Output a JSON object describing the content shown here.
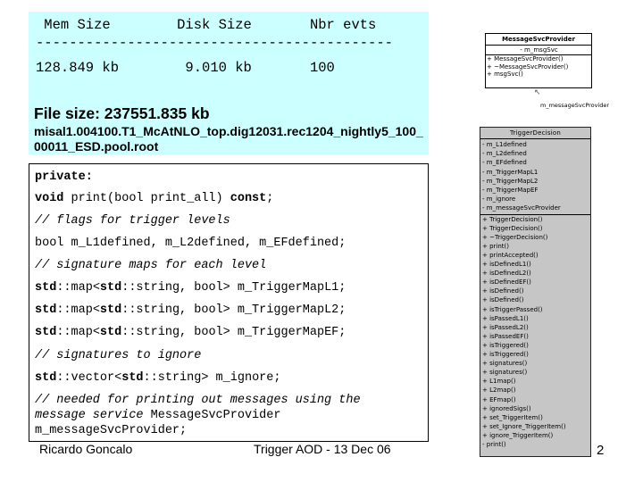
{
  "info": {
    "header": " Mem Size        Disk Size       Nbr evts",
    "dashes": "-------------------------------------------",
    "values": "128.849 kb        9.010 kb       100",
    "file_size": "File size: 237551.835 kb",
    "file_name": "misal1.004100.T1_McAtNLO_top.dig12031.rec1204_nightly5_100_00011_ESD.pool.root"
  },
  "code": [
    {
      "type": "mixed",
      "parts": [
        {
          "text": "private:",
          "bold": true
        }
      ]
    },
    {
      "type": "mixed",
      "parts": [
        {
          "text": "void",
          "bold": true
        },
        {
          "text": " print(bool print_all) ",
          "bold": false
        },
        {
          "text": "const",
          "bold": true
        },
        {
          "text": ";",
          "bold": false
        }
      ]
    },
    {
      "type": "comment",
      "parts": [
        {
          "text": "// flags for trigger levels",
          "bold": false
        }
      ]
    },
    {
      "type": "mixed",
      "parts": [
        {
          "text": "bool m_L1defined, m_L2defined, m_EFdefined;",
          "bold": false
        }
      ]
    },
    {
      "type": "comment",
      "parts": [
        {
          "text": "// signature maps for each level",
          "bold": false
        }
      ]
    },
    {
      "type": "mixed",
      "parts": [
        {
          "text": "std",
          "bold": true
        },
        {
          "text": "::map<",
          "bold": false
        },
        {
          "text": "std",
          "bold": true
        },
        {
          "text": "::string, bool> m_TriggerMapL1;",
          "bold": false
        }
      ]
    },
    {
      "type": "mixed",
      "parts": [
        {
          "text": "std",
          "bold": true
        },
        {
          "text": "::map<",
          "bold": false
        },
        {
          "text": "std",
          "bold": true
        },
        {
          "text": "::string, bool> m_TriggerMapL2;",
          "bold": false
        }
      ]
    },
    {
      "type": "mixed",
      "parts": [
        {
          "text": "std",
          "bold": true
        },
        {
          "text": "::map<",
          "bold": false
        },
        {
          "text": "std",
          "bold": true
        },
        {
          "text": "::string, bool> m_TriggerMapEF;",
          "bold": false
        }
      ]
    },
    {
      "type": "comment",
      "parts": [
        {
          "text": "// signatures to ignore",
          "bold": false
        }
      ]
    },
    {
      "type": "mixed",
      "parts": [
        {
          "text": "std",
          "bold": true
        },
        {
          "text": "::vector<",
          "bold": false
        },
        {
          "text": "std",
          "bold": true
        },
        {
          "text": "::string> m_ignore;",
          "bold": false
        }
      ]
    },
    {
      "type": "comment",
      "parts": [
        {
          "text": "// needed for printing out messages using the",
          "bold": false
        }
      ]
    },
    {
      "type": "mixed",
      "parts": [
        {
          "text": "message service",
          "bold": false,
          "italic": true
        },
        {
          "text": " MessageSvcProvider",
          "bold": false
        }
      ]
    },
    {
      "type": "mixed",
      "parts": [
        {
          "text": "m_messageSvcProvider;",
          "bold": false
        }
      ]
    }
  ],
  "footer": {
    "author": "Ricardo Goncalo",
    "title": "Trigger AOD - 13 Dec 06",
    "page": "2"
  },
  "uml": {
    "message_svc_provider": {
      "name": "MessageSvcProvider",
      "attributes": [
        "- m_msgSvc"
      ],
      "methods": [
        "+ MessageSvcProvider()",
        "+ ~MessageSvcProvider()",
        "+ msgSvc()"
      ]
    },
    "association_label": "m_messageSvcProvider",
    "trigger_decision": {
      "name": "TriggerDecision",
      "attributes": [
        "- m_L1defined",
        "- m_L2defined",
        "- m_EFdefined",
        "- m_TriggerMapL1",
        "- m_TriggerMapL2",
        "- m_TriggerMapEF",
        "- m_ignore",
        "- m_messageSvcProvider"
      ],
      "methods": [
        "+ TriggerDecision()",
        "+ TriggerDecision()",
        "+ ~TriggerDecision()",
        "+ print()",
        "+ printAccepted()",
        "+ isDefinedL1()",
        "+ isDefinedL2()",
        "+ isDefinedEF()",
        "+ isDefined()",
        "+ isDefined()",
        "+ isTriggerPassed()",
        "+ isPassedL1()",
        "+ isPassedL2()",
        "+ isPassedEF()",
        "+ isTriggered()",
        "+ isTriggered()",
        "+ signatures()",
        "+ signatures()",
        "+ L1map()",
        "+ L2map()",
        "+ EFmap()",
        "+ ignoredSigs()",
        "+ set_TriggerItem()",
        "+ set_Ignore_TriggerItem()",
        "+ ignore_TriggerItem()",
        "- print()"
      ]
    }
  }
}
